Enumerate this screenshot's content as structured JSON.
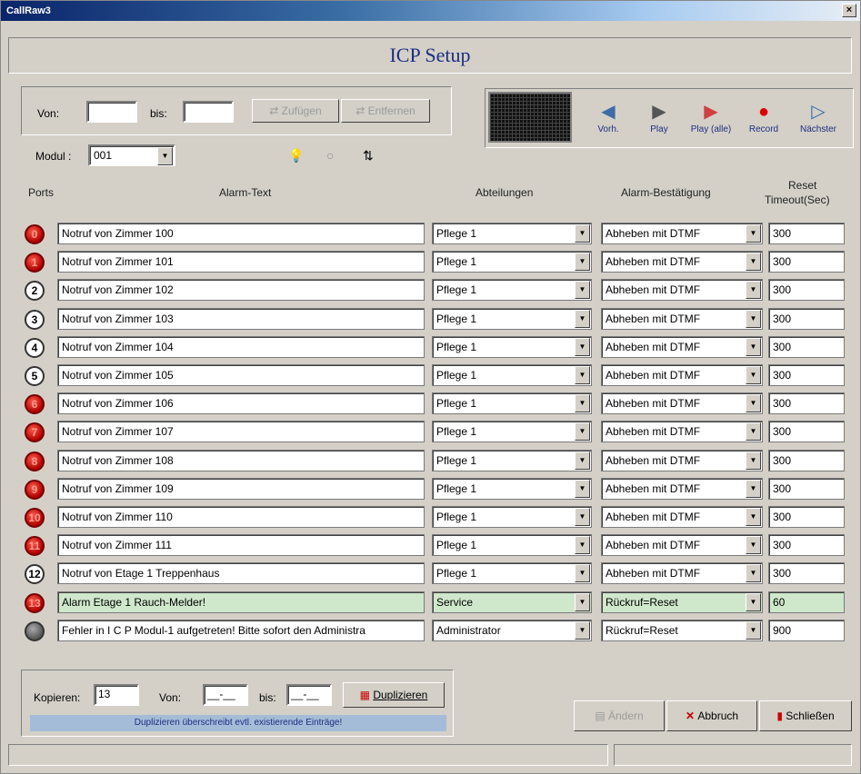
{
  "window": {
    "title": "CallRaw3",
    "close": "×"
  },
  "header": {
    "title": "ICP Setup"
  },
  "range": {
    "von_label": "Von:",
    "von_value": "",
    "bis_label": "bis:",
    "bis_value": "",
    "add_label": "Zufügen",
    "remove_label": "Entfernen"
  },
  "modul": {
    "label": "Modul :",
    "value": "001"
  },
  "controls": {
    "prev": "Vorh.",
    "play": "Play",
    "play_all": "Play (alle)",
    "record": "Record",
    "next": "Nächster"
  },
  "columns": {
    "ports": "Ports",
    "alarm_text": "Alarm-Text",
    "abteilungen": "Abteilungen",
    "bestaetigung": "Alarm-Bestätigung",
    "reset_line1": "Reset",
    "reset_line2": "Timeout(Sec)"
  },
  "rows": [
    {
      "port": "0",
      "port_style": "red",
      "text": "Notruf von Zimmer 100",
      "abteilung": "Pflege 1",
      "bestaetigung": "Abheben mit DTMF",
      "timeout": "300",
      "highlight": false
    },
    {
      "port": "1",
      "port_style": "red",
      "text": "Notruf von Zimmer 101",
      "abteilung": "Pflege 1",
      "bestaetigung": "Abheben mit DTMF",
      "timeout": "300",
      "highlight": false
    },
    {
      "port": "2",
      "port_style": "white",
      "text": "Notruf von Zimmer 102",
      "abteilung": "Pflege 1",
      "bestaetigung": "Abheben mit DTMF",
      "timeout": "300",
      "highlight": false
    },
    {
      "port": "3",
      "port_style": "white",
      "text": "Notruf von Zimmer 103",
      "abteilung": "Pflege 1",
      "bestaetigung": "Abheben mit DTMF",
      "timeout": "300",
      "highlight": false
    },
    {
      "port": "4",
      "port_style": "white",
      "text": "Notruf von Zimmer 104",
      "abteilung": "Pflege 1",
      "bestaetigung": "Abheben mit DTMF",
      "timeout": "300",
      "highlight": false
    },
    {
      "port": "5",
      "port_style": "white",
      "text": "Notruf von Zimmer 105",
      "abteilung": "Pflege 1",
      "bestaetigung": "Abheben mit DTMF",
      "timeout": "300",
      "highlight": false
    },
    {
      "port": "6",
      "port_style": "red",
      "text": "Notruf von Zimmer 106",
      "abteilung": "Pflege 1",
      "bestaetigung": "Abheben mit DTMF",
      "timeout": "300",
      "highlight": false
    },
    {
      "port": "7",
      "port_style": "red",
      "text": "Notruf von Zimmer 107",
      "abteilung": "Pflege 1",
      "bestaetigung": "Abheben mit DTMF",
      "timeout": "300",
      "highlight": false
    },
    {
      "port": "8",
      "port_style": "red",
      "text": "Notruf von Zimmer 108",
      "abteilung": "Pflege 1",
      "bestaetigung": "Abheben mit DTMF",
      "timeout": "300",
      "highlight": false
    },
    {
      "port": "9",
      "port_style": "red",
      "text": "Notruf von Zimmer 109",
      "abteilung": "Pflege 1",
      "bestaetigung": "Abheben mit DTMF",
      "timeout": "300",
      "highlight": false
    },
    {
      "port": "10",
      "port_style": "red",
      "text": "Notruf von Zimmer 110",
      "abteilung": "Pflege 1",
      "bestaetigung": "Abheben mit DTMF",
      "timeout": "300",
      "highlight": false
    },
    {
      "port": "11",
      "port_style": "red",
      "text": "Notruf von Zimmer 111",
      "abteilung": "Pflege 1",
      "bestaetigung": "Abheben mit DTMF",
      "timeout": "300",
      "highlight": false
    },
    {
      "port": "12",
      "port_style": "white",
      "text": "Notruf von Etage 1 Treppenhaus",
      "abteilung": "Pflege 1",
      "bestaetigung": "Abheben mit DTMF",
      "timeout": "300",
      "highlight": false
    },
    {
      "port": "13",
      "port_style": "red",
      "text": "Alarm Etage 1 Rauch-Melder!",
      "abteilung": "Service",
      "bestaetigung": "Rückruf=Reset",
      "timeout": "60",
      "highlight": true
    },
    {
      "port": "",
      "port_style": "grey",
      "text": "Fehler in I C P Modul-1 aufgetreten! Bitte sofort den Administra",
      "abteilung": "Administrator",
      "bestaetigung": "Rückruf=Reset",
      "timeout": "900",
      "highlight": false
    }
  ],
  "copy": {
    "kopieren_label": "Kopieren:",
    "kopieren_value": "13",
    "von_label": "Von:",
    "von_value": "__-__",
    "bis_label": "bis:",
    "bis_value": "__-__",
    "dup_label": "Duplizieren",
    "note": "Duplizieren überschreibt evtl. existierende Einträge!"
  },
  "actions": {
    "aendern": "Ändern",
    "abbruch": "Abbruch",
    "schliessen": "Schließen"
  }
}
